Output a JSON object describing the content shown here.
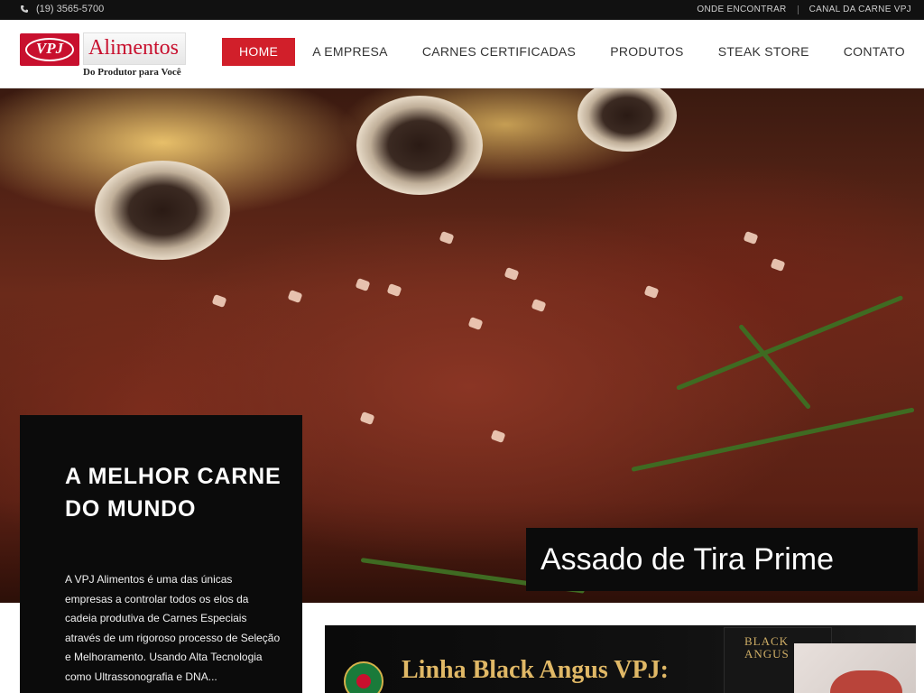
{
  "topbar": {
    "phone": "(19) 3565-5700",
    "links": [
      "ONDE ENCONTRAR",
      "CANAL DA CARNE VPJ"
    ]
  },
  "logo": {
    "badge": "VPJ",
    "name": "Alimentos",
    "tagline": "Do Produtor para Você"
  },
  "nav": {
    "items": [
      "HOME",
      "A EMPRESA",
      "CARNES CERTIFICADAS",
      "PRODUTOS",
      "STEAK STORE",
      "CONTATO"
    ],
    "active": "HOME"
  },
  "hero": {
    "title": "A MELHOR CARNE DO MUNDO",
    "text": "A VPJ Alimentos é uma das únicas empresas a controlar todos os elos da cadeia produtiva de Carnes Especiais através de um rigoroso processo de Seleção e Melhoramento. Usando Alta Tecnologia como Ultrassonografia e DNA...",
    "caption": "Assado de Tira Prime"
  },
  "banner": {
    "title": "Linha Black Angus VPJ:",
    "box_text": "BLACK ANGUS"
  },
  "colors": {
    "accent": "#d11f2a",
    "topbar": "#111111",
    "card": "#0b0b0b",
    "banner_gold": "#e0b866"
  }
}
